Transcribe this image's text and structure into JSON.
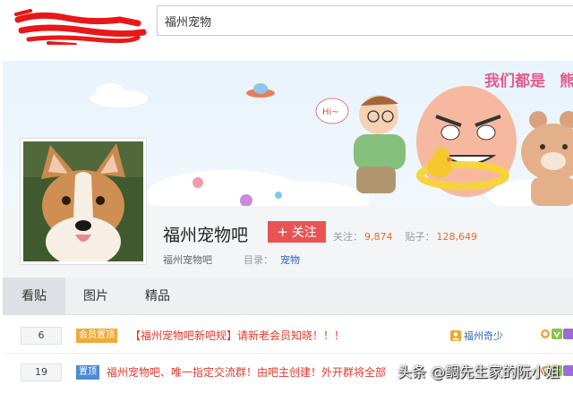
{
  "search": {
    "value": "福州宠物"
  },
  "forum": {
    "name": "福州宠物吧",
    "follow_label": "关注",
    "follow_plus": "+",
    "stats": {
      "followers_label": "关注：",
      "followers": "9,874",
      "posts_label": "贴子：",
      "posts": "128,649"
    },
    "sub_name": "福州宠物吧",
    "catalog_label": "目录：",
    "catalog_value": "宠物"
  },
  "banner": {
    "slogan": "我们都是",
    "speech": "Hi~"
  },
  "tabs": [
    {
      "label": "看贴",
      "active": true
    },
    {
      "label": "图片",
      "active": false
    },
    {
      "label": "精品",
      "active": false
    }
  ],
  "posts": [
    {
      "replies": "6",
      "badge": "会员置顶",
      "badge_type": "member",
      "title": "【福州宠物吧新吧规】请新老会员知晓！！！",
      "author": "福州奇少"
    },
    {
      "replies": "19",
      "badge": "置顶",
      "badge_type": "top",
      "title": "福州宠物吧、唯一指定交流群！由吧主创建！外开群将全部",
      "author": ""
    }
  ],
  "watermark": "头条 @鲷先生家的阮小姐",
  "colors": {
    "accent": "#e85454",
    "stat_number": "#e66b2c",
    "link": "#2d64b3",
    "post_title": "#e0382c"
  }
}
